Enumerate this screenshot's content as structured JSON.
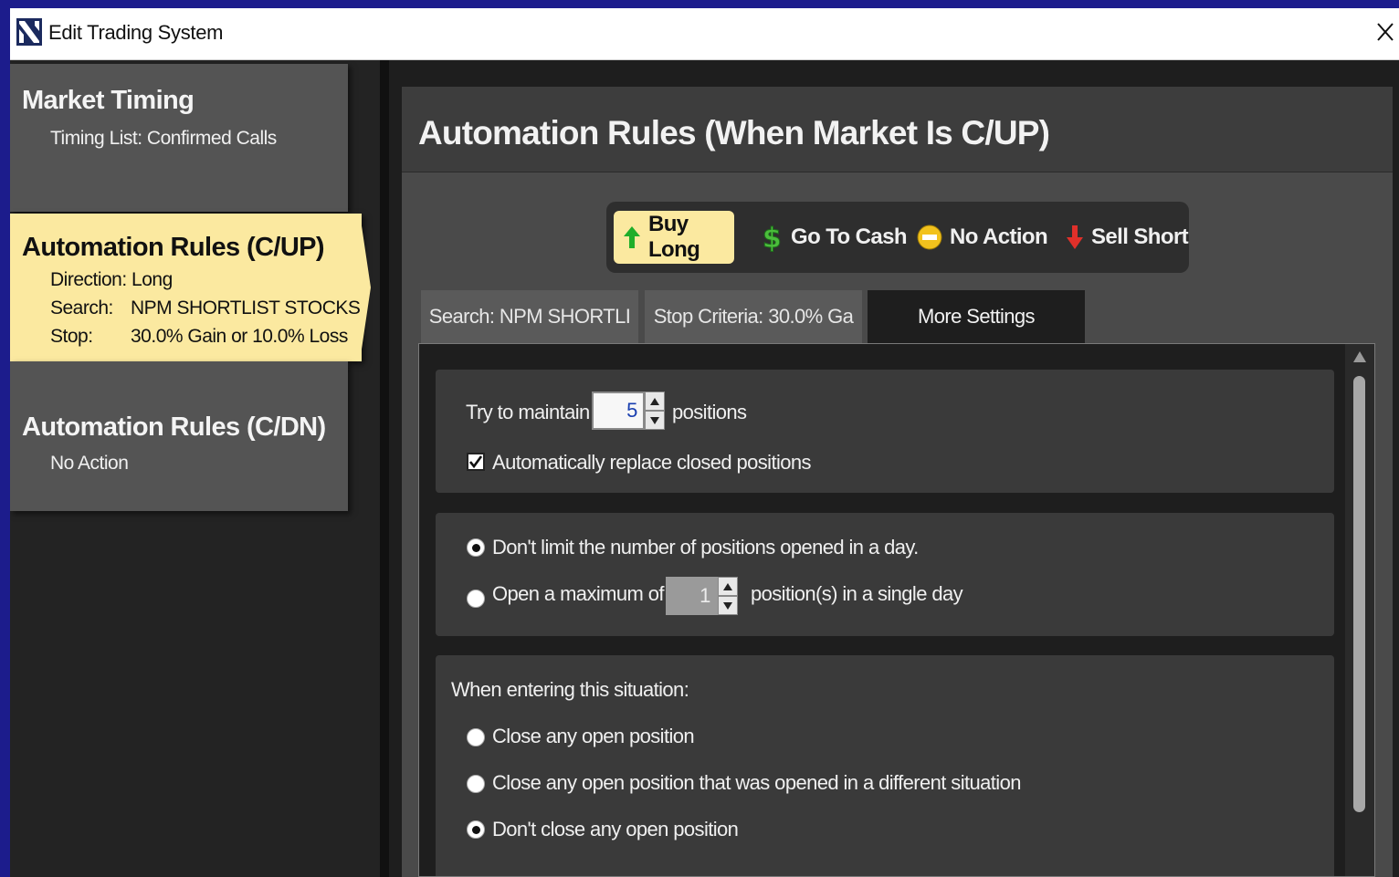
{
  "window": {
    "title": "Edit Trading System",
    "logo_icon": "app-logo-icon",
    "close_icon": "close-icon"
  },
  "nav": {
    "market": {
      "title": "Market Timing",
      "subtitle": "Timing List: Confirmed Calls"
    },
    "cup": {
      "title": "Automation Rules (C/UP)",
      "direction": "Direction: Long",
      "search_label": "Search:",
      "search_value": "NPM SHORTLIST STOCKS",
      "stop_label": "Stop:",
      "stop_value": "30.0% Gain or 10.0% Loss"
    },
    "cdn": {
      "title": "Automation Rules (C/DN)",
      "subtitle": "No Action"
    }
  },
  "panel": {
    "title": "Automation Rules (When Market Is C/UP)",
    "actions": [
      {
        "label": "Buy Long",
        "icon": "green-up-arrow-icon",
        "active": true
      },
      {
        "label": "Go To Cash",
        "icon": "dollar-sign-icon",
        "active": false
      },
      {
        "label": "No Action",
        "icon": "minus-circle-icon",
        "active": false
      },
      {
        "label": "Sell Short",
        "icon": "red-down-arrow-icon",
        "active": false
      }
    ],
    "tabs": [
      {
        "label": "Search:  NPM SHORTLI",
        "active": false
      },
      {
        "label": "Stop Criteria: 30.0% Ga",
        "active": false
      },
      {
        "label": "More Settings",
        "active": true
      }
    ]
  },
  "settings": {
    "maintain_label": "Try to maintain",
    "maintain_value": "5",
    "maintain_suffix": "positions",
    "auto_replace_label": "Automatically replace closed positions",
    "auto_replace_checked": true,
    "limit_options": [
      {
        "label": "Don't limit the number of positions opened in a day.",
        "selected": true
      },
      {
        "label": "Open a maximum of",
        "selected": false
      }
    ],
    "max_per_day_value": "1",
    "max_per_day_suffix": "position(s) in a single day",
    "entering_label": "When entering this situation:",
    "entering_options": [
      {
        "label": "Close any open position",
        "selected": false
      },
      {
        "label": "Close any open position that was opened in a different situation",
        "selected": false
      },
      {
        "label": "Don't close any open position",
        "selected": true
      }
    ]
  },
  "colors": {
    "highlight": "#fbe9a0",
    "card": "#545454",
    "panel": "#4a4a4a",
    "desktop": "#1c1c8c"
  }
}
